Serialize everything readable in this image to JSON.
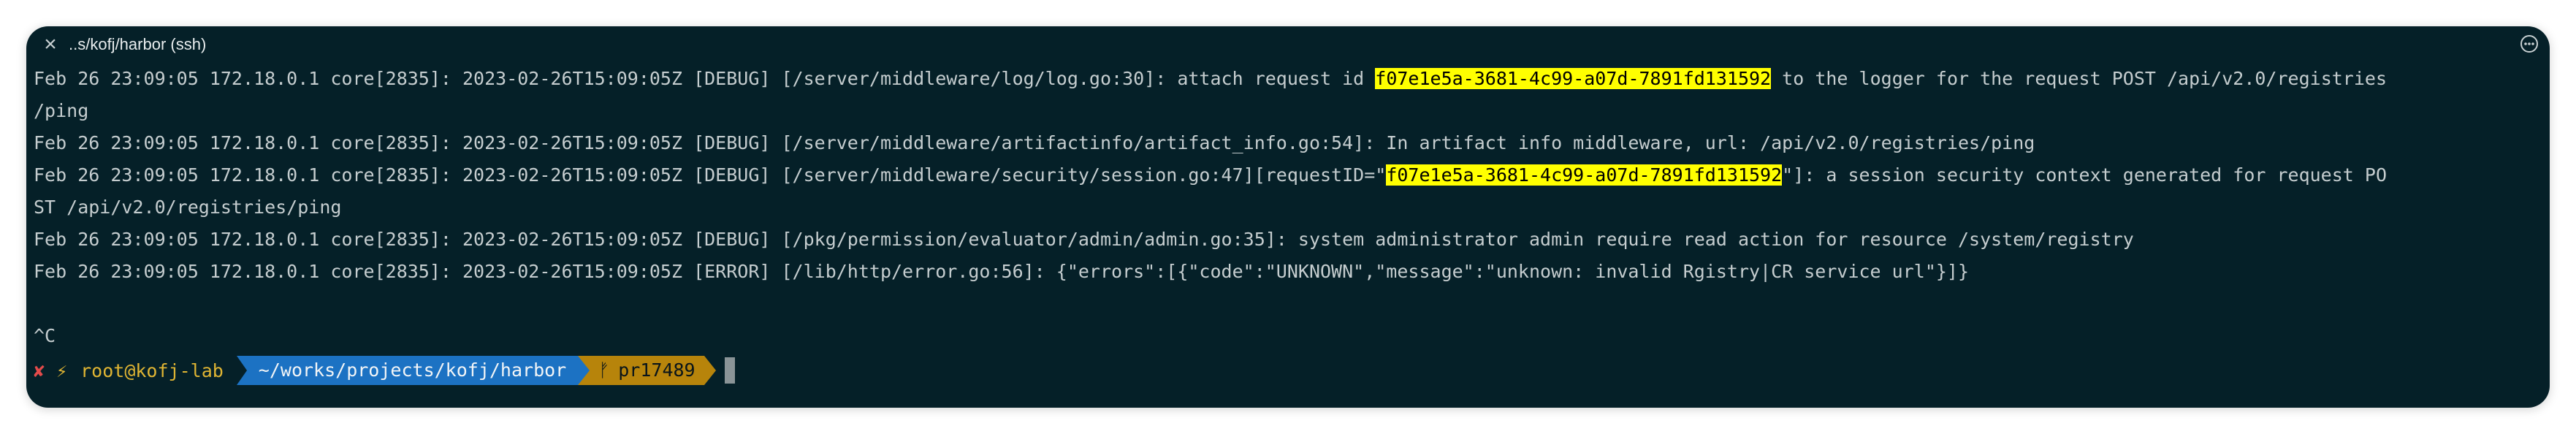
{
  "window": {
    "title": "..s/kofj/harbor (ssh)"
  },
  "terminal": {
    "lines": [
      {
        "pre": "Feb 26 23:09:05 172.18.0.1 core[2835]: 2023-02-26T15:09:05Z [DEBUG] [/server/middleware/log/log.go:30]: attach request id ",
        "hl": "f07e1e5a-3681-4c99-a07d-7891fd131592",
        "post": " to the logger for the request POST /api/v2.0/registries"
      },
      {
        "pre": "/ping",
        "hl": "",
        "post": ""
      },
      {
        "pre": "Feb 26 23:09:05 172.18.0.1 core[2835]: 2023-02-26T15:09:05Z [DEBUG] [/server/middleware/artifactinfo/artifact_info.go:54]: In artifact info middleware, url: /api/v2.0/registries/ping",
        "hl": "",
        "post": ""
      },
      {
        "pre": "Feb 26 23:09:05 172.18.0.1 core[2835]: 2023-02-26T15:09:05Z [DEBUG] [/server/middleware/security/session.go:47][requestID=\"",
        "hl": "f07e1e5a-3681-4c99-a07d-7891fd131592",
        "post": "\"]: a session security context generated for request PO"
      },
      {
        "pre": "ST /api/v2.0/registries/ping",
        "hl": "",
        "post": ""
      },
      {
        "pre": "Feb 26 23:09:05 172.18.0.1 core[2835]: 2023-02-26T15:09:05Z [DEBUG] [/pkg/permission/evaluator/admin/admin.go:35]: system administrator admin require read action for resource /system/registry",
        "hl": "",
        "post": ""
      },
      {
        "pre": "Feb 26 23:09:05 172.18.0.1 core[2835]: 2023-02-26T15:09:05Z [ERROR] [/lib/http/error.go:56]: {\"errors\":[{\"code\":\"UNKNOWN\",\"message\":\"unknown: invalid Rgistry|CR service url\"}]}",
        "hl": "",
        "post": ""
      },
      {
        "pre": "",
        "hl": "",
        "post": ""
      },
      {
        "pre": "^C",
        "hl": "",
        "post": ""
      }
    ]
  },
  "prompt": {
    "status_symbol": "✘",
    "bolt_symbol": "⚡",
    "user_host": "root@kofj-lab",
    "path": "~/works/projects/kofj/harbor",
    "branch_symbol": "ᚠ",
    "branch": "pr17489"
  },
  "colors": {
    "background": "#052028",
    "text": "#c5cdcf",
    "highlight": "#ffff00",
    "path_segment": "#1c72c3",
    "git_segment": "#b7840b",
    "error_symbol": "#e34b4b",
    "user_host": "#e0b533"
  }
}
